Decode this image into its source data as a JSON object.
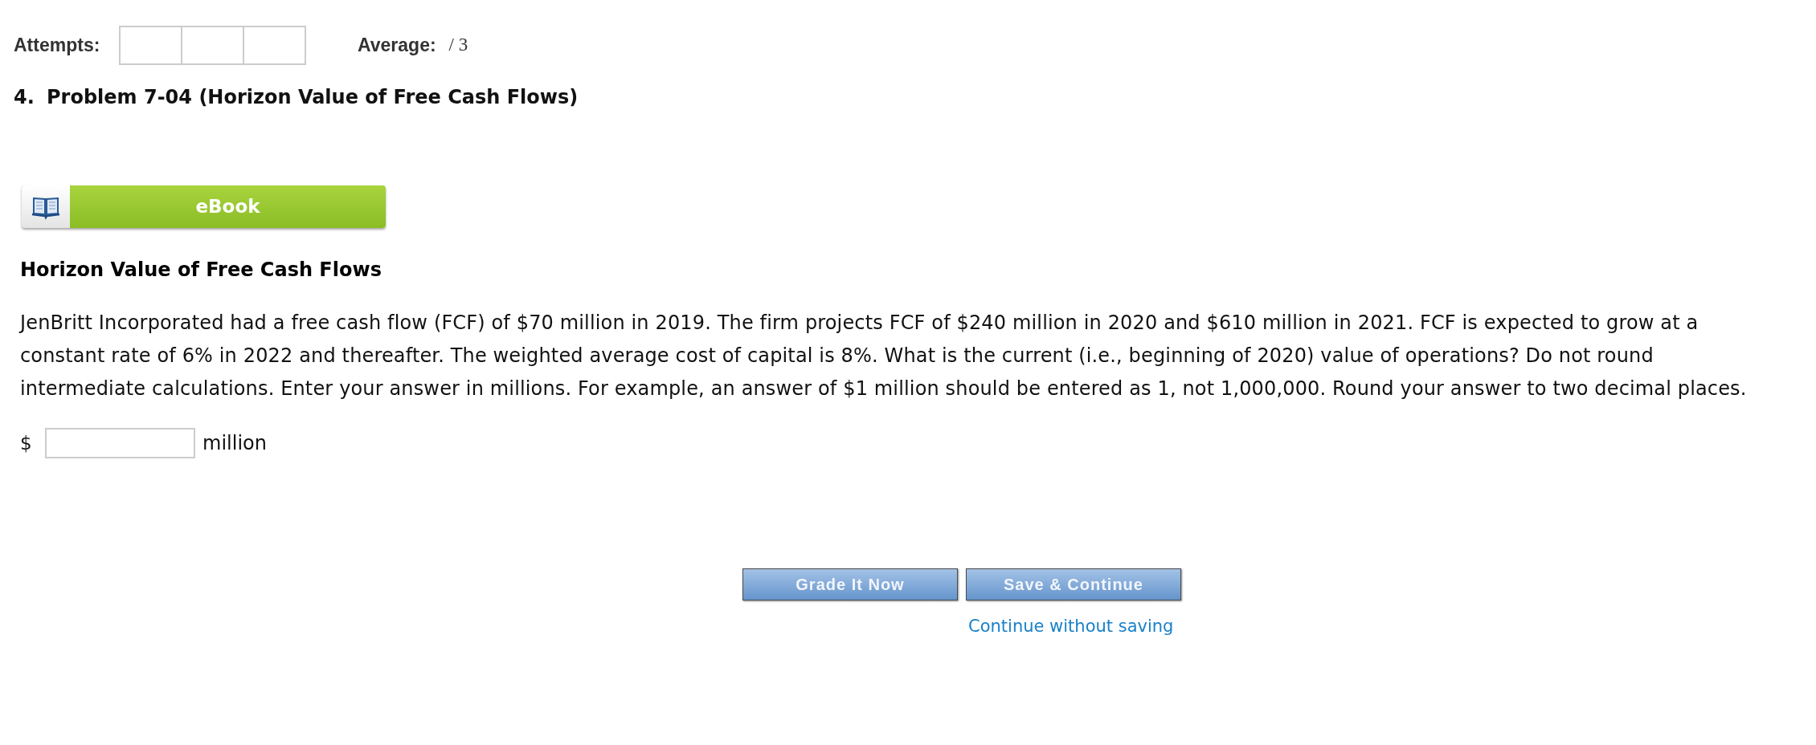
{
  "attempts": {
    "label": "Attempts:",
    "slots": [
      {
        "used": false
      },
      {
        "used": false
      },
      {
        "used": false
      }
    ]
  },
  "average": {
    "label": "Average:",
    "value": "/ 3"
  },
  "problem": {
    "number": "4.",
    "title": "Problem 7-04 (Horizon Value of Free Cash Flows)"
  },
  "ebook_button": {
    "label": "eBook"
  },
  "section_heading": "Horizon Value of Free Cash Flows",
  "question": "JenBritt Incorporated had a free cash flow (FCF) of $70 million in 2019. The firm projects FCF of $240 million in 2020 and $610 million in 2021. FCF is expected to grow at a constant rate of 6% in 2022 and thereafter. The weighted average cost of capital is 8%. What is the current (i.e., beginning of 2020) value of operations? Do not round intermediate calculations. Enter your answer in millions. For example, an answer of $1 million should be entered as 1, not 1,000,000. Round your answer to two decimal places.",
  "answer": {
    "prefix": "$",
    "unit": "million"
  },
  "buttons": [
    {
      "label": "Grade It Now"
    },
    {
      "label": "Save & Continue"
    }
  ],
  "link": "Continue without saving"
}
